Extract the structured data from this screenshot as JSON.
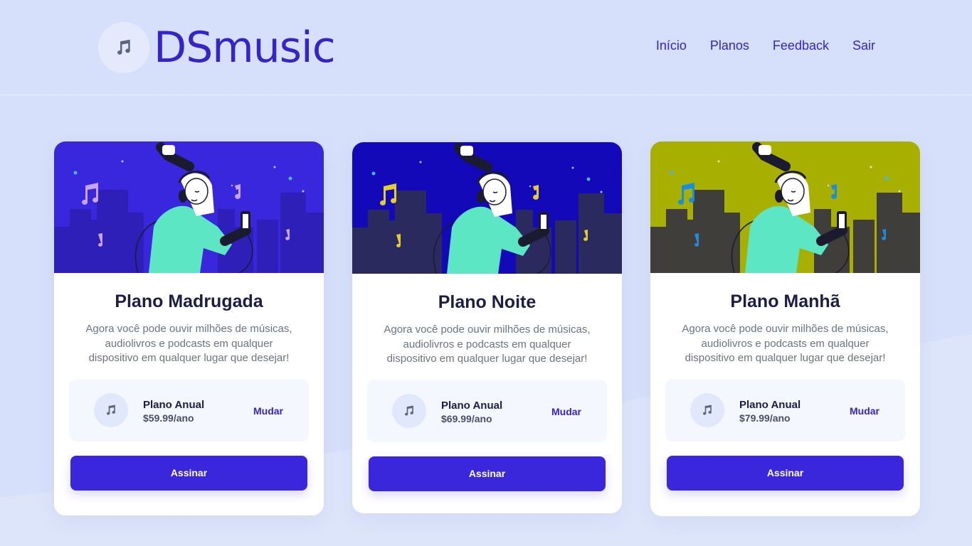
{
  "brand": {
    "name": "DSmusic",
    "icon": "music-note-icon",
    "color": "#3524c7"
  },
  "nav": {
    "items": [
      {
        "label": "Início"
      },
      {
        "label": "Planos"
      },
      {
        "label": "Feedback"
      },
      {
        "label": "Sair"
      }
    ]
  },
  "cards": [
    {
      "title": "Plano Madrugada",
      "description": "Agora você pode ouvir milhões de músicas, audiolivros e podcasts em qualquer dispositivo em qualquer lugar que desejar!",
      "plan_name": "Plano Anual",
      "plan_price": "$59.99/ano",
      "change_label": "Mudar",
      "button_label": "Assinar",
      "colors": {
        "sky": "#3827dd",
        "buildings": "#2d1fb8",
        "notes": "#c9a3f5"
      }
    },
    {
      "title": "Plano Noite",
      "description": "Agora você pode ouvir milhões de músicas, audiolivros e podcasts em qualquer dispositivo em qualquer lugar que desejar!",
      "plan_name": "Plano Anual",
      "plan_price": "$69.99/ano",
      "change_label": "Mudar",
      "button_label": "Assinar",
      "colors": {
        "sky": "#1309b8",
        "buildings": "#2a2a5e",
        "notes": "#e3cf2b"
      }
    },
    {
      "title": "Plano Manhã",
      "description": "Agora você pode ouvir milhões de músicas, audiolivros e podcasts em qualquer dispositivo em qualquer lugar que desejar!",
      "plan_name": "Plano Anual",
      "plan_price": "$79.99/ano",
      "change_label": "Mudar",
      "button_label": "Assinar",
      "colors": {
        "sky": "#a7b000",
        "buildings": "#403e3a",
        "notes": "#1c8ce0"
      }
    }
  ],
  "accent": "#3a27dc"
}
